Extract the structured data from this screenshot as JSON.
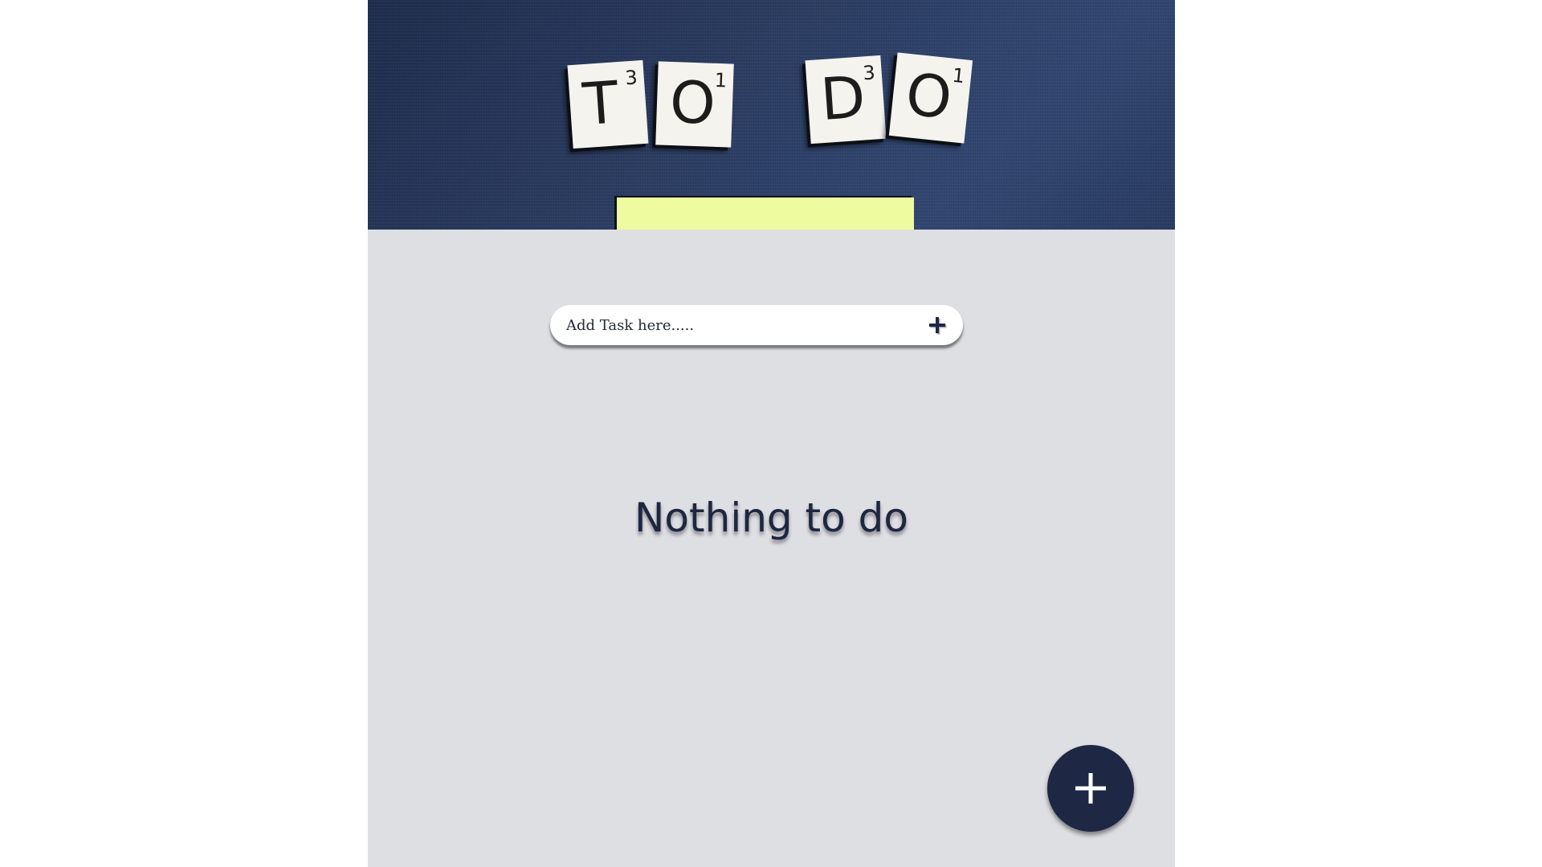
{
  "header": {
    "tiles": [
      {
        "letter": "T",
        "score": "3"
      },
      {
        "letter": "O",
        "score": "1"
      },
      {
        "letter": "D",
        "score": "3"
      },
      {
        "letter": "O",
        "score": "1"
      }
    ]
  },
  "add_task": {
    "placeholder": "Add Task here.....",
    "button_icon": "plus-icon"
  },
  "empty_state": {
    "message": "Nothing to do"
  },
  "fab": {
    "icon": "plus-icon"
  },
  "colors": {
    "page_bg": "#ffffff",
    "app_bg": "#dedfe3",
    "header_bg": "#2c3e63",
    "accent_navy": "#1e2744",
    "note_yellow": "#eefb9f",
    "text_dark": "#1d2740"
  }
}
